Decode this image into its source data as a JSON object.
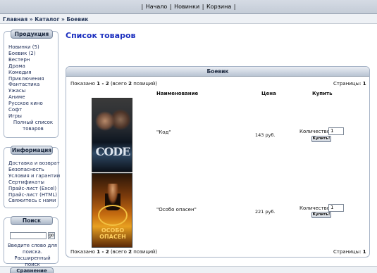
{
  "topnav": {
    "links": [
      "Начало",
      "Новинки",
      "Корзина"
    ]
  },
  "breadcrumb": "Главная » Каталог » Боевик",
  "sidebar": {
    "products": {
      "title": "Продукция",
      "items": [
        {
          "label": "Новинки (5)"
        },
        {
          "label": "Боевик (2)"
        },
        {
          "label": "Вестерн"
        },
        {
          "label": "Драма"
        },
        {
          "label": "Комедия"
        },
        {
          "label": "Приключения"
        },
        {
          "label": "Фантастика"
        },
        {
          "label": "Ужасы"
        },
        {
          "label": "Аниме"
        },
        {
          "label": "Русское кино"
        },
        {
          "label": "Софт"
        },
        {
          "label": "Игры"
        }
      ],
      "full_list_1": "Полный список",
      "full_list_2": "товаров"
    },
    "info": {
      "title": "Информация",
      "items": [
        {
          "label": "Доставка и возврат"
        },
        {
          "label": "Безопасность"
        },
        {
          "label": "Условия и гарантии"
        },
        {
          "label": "Сертификаты"
        },
        {
          "label": "Прайс-лист (Excel)"
        },
        {
          "label": "Прайс-лист (HTML)"
        },
        {
          "label": "Свяжитесь с нами"
        }
      ]
    },
    "search": {
      "title": "Поиск",
      "go_label": "go",
      "hint_1": "Введите слово для",
      "hint_2": "поиска.",
      "advanced": "Расширенный поиск"
    },
    "bottom_tab": "Сравнение"
  },
  "main": {
    "title": "Список товаров",
    "box_title": "Боевик",
    "shown_prefix": "Показано",
    "shown_range": "1 - 2",
    "shown_suffix": "(всего",
    "shown_total": "2",
    "shown_end": "позиций)",
    "pages_label": "Страницы:",
    "pages_value": "1",
    "columns": {
      "name": "Наименование",
      "price": "Цена",
      "buy": "Купить"
    },
    "products": [
      {
        "name": "\"Код\"",
        "price": "143 руб.",
        "qty_label": "Количество:",
        "qty": "1",
        "buy_label": "Купить!",
        "poster_title": "CODE",
        "poster_icon": "code-movie-poster"
      },
      {
        "name": "\"Особо опасен\"",
        "price": "221 руб.",
        "qty_label": "Количество:",
        "qty": "1",
        "buy_label": "Купить!",
        "poster_title": "ОСОБО ОПАСЕН",
        "poster_icon": "wanted-movie-poster"
      }
    ]
  }
}
